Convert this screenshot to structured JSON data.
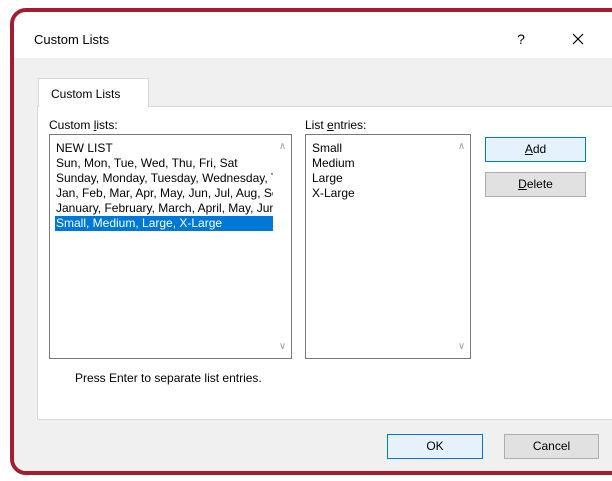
{
  "window": {
    "title": "Custom Lists",
    "help_label": "?",
    "close_icon": "close-icon"
  },
  "tab": {
    "label": "Custom Lists"
  },
  "custom_lists": {
    "label_pre": "Custom ",
    "label_accel": "l",
    "label_post": "ists:",
    "items": [
      "NEW LIST",
      "Sun, Mon, Tue, Wed, Thu, Fri, Sat",
      "Sunday, Monday, Tuesday, Wednesday, Thursday, Friday, Saturday",
      "Jan, Feb, Mar, Apr, May, Jun, Jul, Aug, Sep, Oct, Nov, Dec",
      "January, February, March, April, May, June, July, August, September, October, November, December",
      "Small, Medium, Large, X-Large"
    ],
    "selected_index": 5
  },
  "list_entries": {
    "label_pre": "List ",
    "label_accel": "e",
    "label_post": "ntries:",
    "items": [
      "Small",
      "Medium",
      "Large",
      "X-Large"
    ]
  },
  "buttons": {
    "add_accel": "A",
    "add_rest": "dd",
    "delete_accel": "D",
    "delete_rest": "elete",
    "ok": "OK",
    "cancel": "Cancel"
  },
  "hint": "Press Enter to separate list entries.",
  "colors": {
    "frame_border": "#a51c30",
    "selection": "#0078d7",
    "dialog_bg": "#f0f0f0"
  }
}
